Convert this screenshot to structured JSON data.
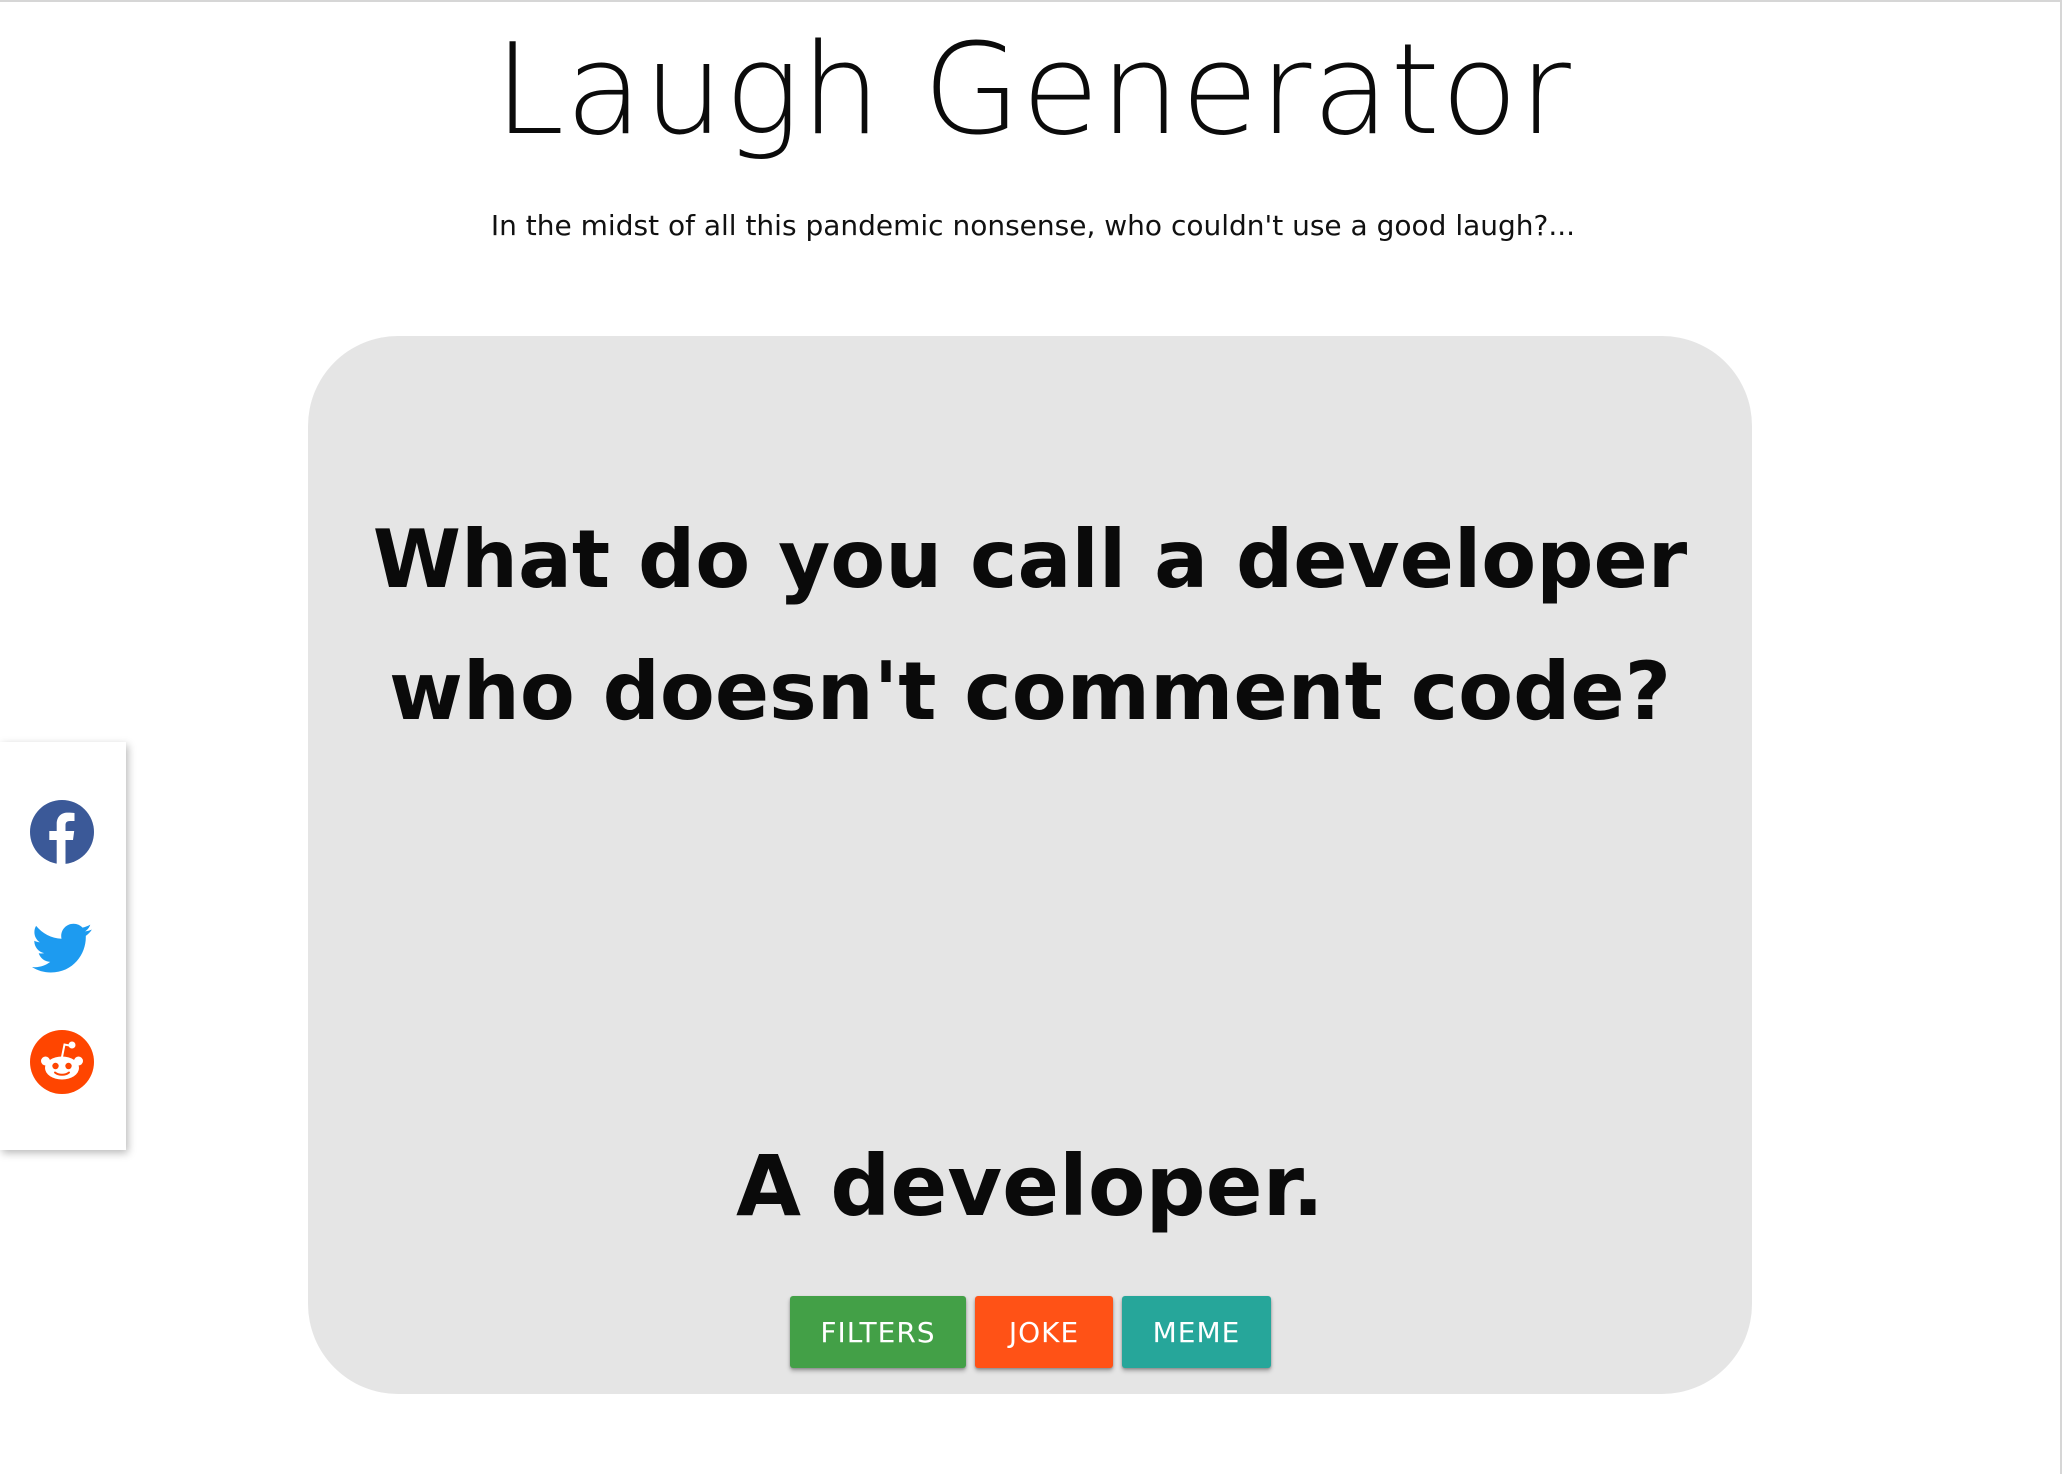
{
  "header": {
    "title": "Laugh Generator",
    "tagline": "In the midst of all this pandemic nonsense, who couldn't use a good laugh?..."
  },
  "joke": {
    "setup": "What do you call a developer who doesn't comment code?",
    "punchline": "A developer."
  },
  "actions": {
    "filters_label": "FILTERS",
    "joke_label": "JOKE",
    "meme_label": "MEME"
  },
  "share": {
    "items": [
      {
        "icon": "facebook-icon",
        "color": "#3b5998"
      },
      {
        "icon": "twitter-icon",
        "color": "#1da1f2"
      },
      {
        "icon": "reddit-icon",
        "color": "#ff4500"
      }
    ]
  },
  "colors": {
    "card_background": "#e5e5e5",
    "filters_button": "#43a047",
    "joke_button": "#ff5216",
    "meme_button": "#26a69a"
  }
}
